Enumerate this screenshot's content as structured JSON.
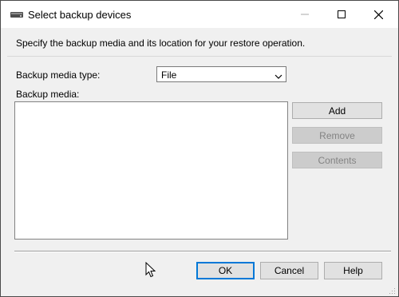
{
  "window": {
    "title": "Select backup devices",
    "icon": "backup-device-icon",
    "controls": {
      "minimize": "minimize-icon",
      "maximize": "maximize-icon",
      "close": "close-icon"
    }
  },
  "dialog": {
    "instruction": "Specify the backup media and its location for your restore operation.",
    "media_type_label": "Backup media type:",
    "media_type_value": "File",
    "media_label": "Backup media:",
    "media_items": [],
    "buttons": {
      "add": "Add",
      "remove": "Remove",
      "contents": "Contents",
      "ok": "OK",
      "cancel": "Cancel",
      "help": "Help"
    }
  },
  "colors": {
    "default_button_border": "#0078d7",
    "disabled_text": "#838383"
  }
}
